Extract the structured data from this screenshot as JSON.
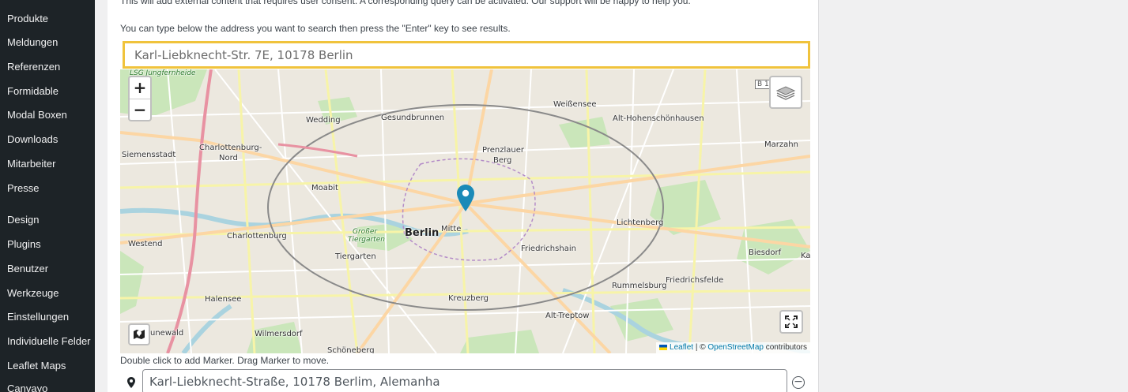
{
  "sidebar": {
    "items": [
      {
        "label": "Produkte"
      },
      {
        "label": "Meldungen"
      },
      {
        "label": "Referenzen"
      },
      {
        "label": "Formidable"
      },
      {
        "label": "Modal Boxen"
      },
      {
        "label": "Downloads"
      },
      {
        "label": "Mitarbeiter"
      },
      {
        "label": "Presse"
      },
      {
        "label": "Design"
      },
      {
        "label": "Plugins"
      },
      {
        "label": "Benutzer"
      },
      {
        "label": "Werkzeuge"
      },
      {
        "label": "Einstellungen"
      },
      {
        "label": "Individuelle Felder"
      },
      {
        "label": "Leaflet Maps"
      },
      {
        "label": "Canvayo"
      }
    ]
  },
  "main": {
    "consent_note": "This will add external content that requires user consent. A corresponding query can be activated. Our support will be happy to help you.",
    "search_hint": "You can type below the address you want to search then press the \"Enter\" key to see results.",
    "search": {
      "placeholder": "Karl-Liebknecht-Str. 7E, 10178 Berlin"
    },
    "map": {
      "zoom_in": "+",
      "zoom_out": "−",
      "labels": {
        "jungfernheide": "LSG Jungfernheide",
        "wedding": "Wedding",
        "gesundbrunnen": "Gesundbrunnen",
        "weissensee": "Weißensee",
        "alt_hohenschoenhausen": "Alt-Hohenschönhausen",
        "charlottenburg_nord_1": "Charlottenburg-",
        "charlottenburg_nord_2": "Nord",
        "siemensstadt": "Siemensstadt",
        "prenzlauer_1": "Prenzlauer",
        "prenzlauer_2": "Berg",
        "marzahn": "Marzahn",
        "moabit": "Moabit",
        "berlin": "Berlin",
        "mitte": "Mitte",
        "grosser_1": "Großer",
        "grosser_2": "Tiergarten",
        "lichtenberg": "Lichtenberg",
        "westend": "Westend",
        "charlottenburg": "Charlottenburg",
        "tiergarten": "Tiergarten",
        "friedrichshain": "Friedrichshain",
        "biesdorf": "Biesdorf",
        "ka": "Ka",
        "friedrichsfelde": "Friedrichsfelde",
        "rummelsburg": "Rummelsburg",
        "halensee": "Halensee",
        "kreuzberg": "Kreuzberg",
        "alt_treptow": "Alt-Treptow",
        "grunewald": "unewald",
        "wilmersdorf": "Wilmersdorf",
        "schoeneberg": "Schöneberg",
        "b1": "B 1"
      },
      "attribution": {
        "leaflet": "Leaflet",
        "sep": " | © ",
        "osm": "OpenStreetMap",
        "contributors": " contributors"
      },
      "marker_color": "#1a8ab8"
    },
    "dbl_click_hint": "Double click to add Marker. Drag Marker to move.",
    "marker_address": {
      "value": "Karl-Liebknecht-Straße, 10178 Berlim, Alemanha"
    },
    "remove_symbol": "−"
  },
  "colors": {
    "sidebar_bg": "#1d2327",
    "search_border": "#f0c33c",
    "link": "#0078a8"
  }
}
